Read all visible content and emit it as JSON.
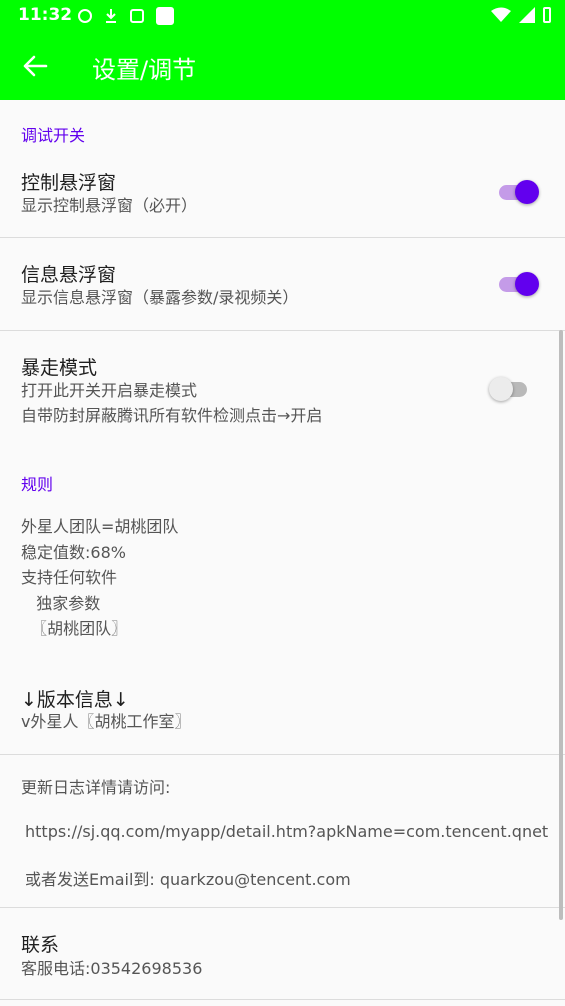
{
  "status_bar": {
    "time": "11:32",
    "icons": [
      "shield-x-icon",
      "download-icon",
      "font-icon",
      "square-icon",
      "wifi-icon",
      "signal-icon",
      "battery-icon"
    ]
  },
  "app_bar": {
    "title": "设置/调节",
    "back_icon": "arrow-left-icon"
  },
  "debug_section": {
    "header": "调试开关",
    "items": [
      {
        "title": "控制悬浮窗",
        "summary": "显示控制悬浮窗（必开）",
        "enabled": true
      },
      {
        "title": "信息悬浮窗",
        "summary": "显示信息悬浮窗（暴露参数/录视频关）",
        "enabled": true
      },
      {
        "title": "暴走模式",
        "summary_line1": "打开此开关开启暴走模式",
        "summary_line2": "自带防封屏蔽腾讯所有软件检测点击→开启",
        "enabled": false
      }
    ]
  },
  "rules_section": {
    "header": "规则",
    "text": "外星人团队=胡桃团队\n稳定值数:68%\n支持任何软件\n   独家参数\n  〖胡桃团队〗"
  },
  "version": {
    "title": "↓版本信息↓",
    "summary": "v外星人〖胡桃工作室〗"
  },
  "changelog": {
    "intro": "更新日志详情请访问:",
    "url": "https://sj.qq.com/myapp/detail.htm?apkName=com.tencent.qnet",
    "email_line": "或者发送Email到: quarkzou@tencent.com"
  },
  "contact": {
    "title": "联系",
    "summary": "客服电话:03542698536"
  },
  "colors": {
    "appbar": "#00ff00",
    "accent": "#6200ee"
  }
}
